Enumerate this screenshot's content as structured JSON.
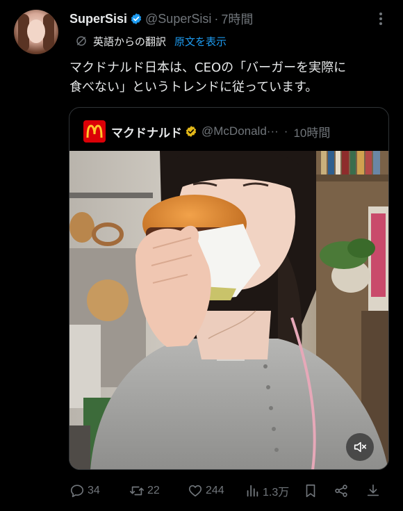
{
  "author": {
    "display_name": "SuperSisi",
    "handle": "@SuperSisi",
    "separator": "·",
    "time": "7時間"
  },
  "translation": {
    "label": "英語からの翻訳",
    "show_original": "原文を表示"
  },
  "tweet_text": "マクドナルド日本は、CEOの「バーガーを実際に\n食べない」というトレンドに従っています。",
  "quoted": {
    "logo_letter": "M",
    "display_name": "マクドナルド",
    "handle": "@McDonald···",
    "separator": "·",
    "time": "10時間"
  },
  "actions": {
    "replies": "34",
    "reposts": "22",
    "likes": "244",
    "views": "1.3万"
  },
  "colors": {
    "background": "#000000",
    "text": "#e7e9ea",
    "muted": "#71767b",
    "link": "#1d9bf0",
    "verified_blue": "#1d9bf0",
    "verified_gold": "#e2b719",
    "mcdonalds_red": "#db0007",
    "mcdonalds_yellow": "#ffc72c"
  },
  "icons": {
    "more": "more-vertical-icon",
    "translate": "translate-icon",
    "reply": "reply-icon",
    "repost": "repost-icon",
    "like": "heart-icon",
    "views": "analytics-icon",
    "bookmark": "bookmark-icon",
    "share": "share-icon",
    "download": "download-icon",
    "mute": "volume-mute-icon"
  }
}
